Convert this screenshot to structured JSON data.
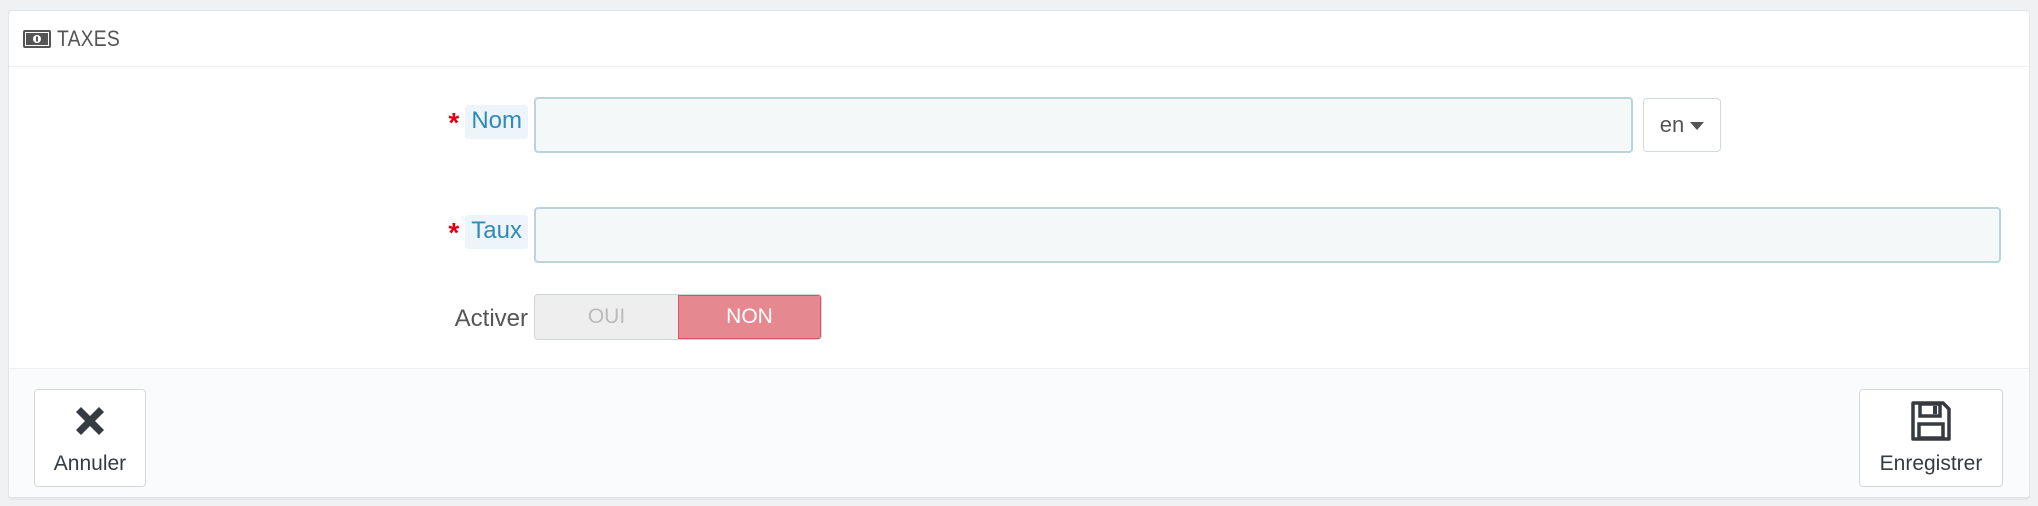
{
  "panel": {
    "title": "TAXES",
    "icon": "money-icon"
  },
  "form": {
    "name": {
      "label": "Nom",
      "required_mark": "*",
      "value": "",
      "lang": "en"
    },
    "rate": {
      "label": "Taux",
      "required_mark": "*",
      "value": ""
    },
    "enable": {
      "label": "Activer",
      "yes_label": "OUI",
      "no_label": "NON",
      "selected": "NON"
    }
  },
  "footer": {
    "cancel_label": "Annuler",
    "save_label": "Enregistrer"
  },
  "colors": {
    "required": "#e10012",
    "switch_off": "#e6888f",
    "label_hint_text": "#2e8ab8"
  }
}
